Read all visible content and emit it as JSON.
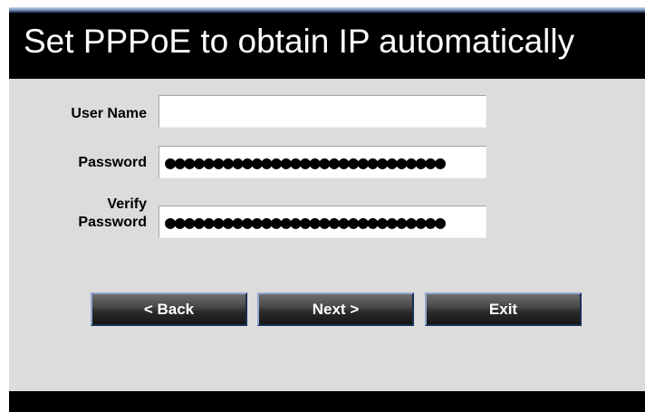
{
  "window": {
    "title": "Set PPPoE to obtain IP automatically"
  },
  "form": {
    "user_name": {
      "label": "User Name",
      "value": ""
    },
    "password": {
      "label": "Password",
      "value": "●●●●●●●●●●●●●●●●●●●●●●●●●●●●●"
    },
    "verify_password": {
      "label_line1": "Verify",
      "label_line2": "Password",
      "value": "●●●●●●●●●●●●●●●●●●●●●●●●●●●●●"
    }
  },
  "buttons": {
    "back": "< Back",
    "next": "Next >",
    "exit": "Exit"
  },
  "colors": {
    "title_bar": "#000000",
    "title_text": "#ffffff",
    "panel_background": "#dcdcdc",
    "button_background": "#2a2a2a",
    "button_border": "#8ea8d0"
  }
}
